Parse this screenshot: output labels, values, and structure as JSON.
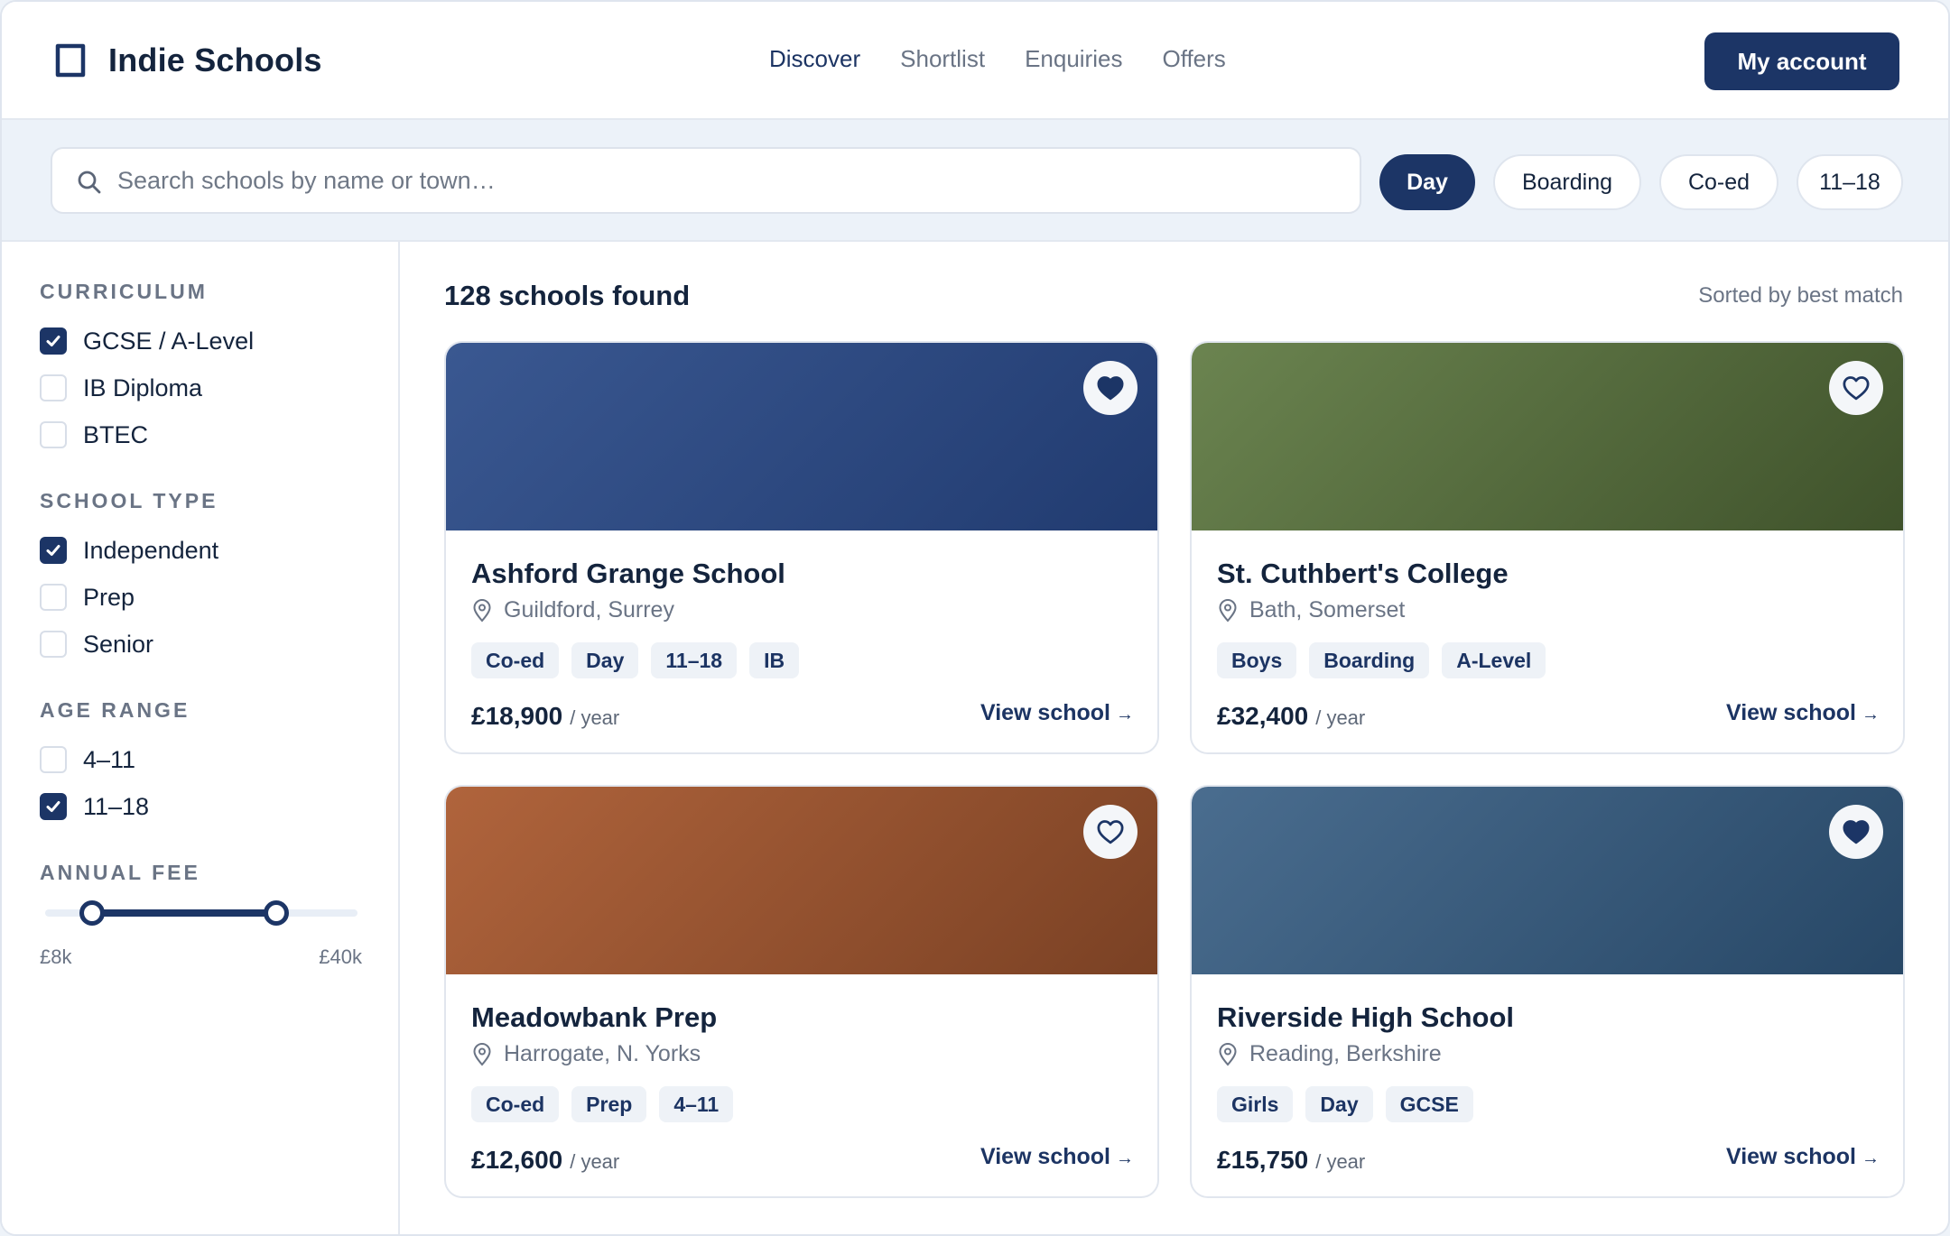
{
  "header": {
    "brand": "Indie Schools",
    "nav": [
      "Discover",
      "Shortlist",
      "Enquiries",
      "Offers"
    ],
    "account_label": "My account"
  },
  "search": {
    "placeholder": "Search schools by name or town…",
    "value": "",
    "chips": [
      {
        "label": "Day",
        "active": true
      },
      {
        "label": "Boarding",
        "active": false
      },
      {
        "label": "Co-ed",
        "active": false
      },
      {
        "label": "11–18",
        "active": false
      }
    ]
  },
  "filters": {
    "curriculum": {
      "title": "CURRICULUM",
      "options": [
        {
          "label": "GCSE / A-Level",
          "checked": true
        },
        {
          "label": "IB Diploma",
          "checked": false
        },
        {
          "label": "BTEC",
          "checked": false
        }
      ]
    },
    "school_type": {
      "title": "SCHOOL TYPE",
      "options": [
        {
          "label": "Independent",
          "checked": true
        },
        {
          "label": "Prep",
          "checked": false
        },
        {
          "label": "Senior",
          "checked": false
        }
      ]
    },
    "age_range": {
      "title": "AGE RANGE",
      "options": [
        {
          "label": "4–11",
          "checked": false
        },
        {
          "label": "11–18",
          "checked": true
        }
      ]
    },
    "annual_fee": {
      "title": "ANNUAL FEE",
      "min_label": "£8k",
      "max_label": "£40k",
      "range_fraction": [
        0.15,
        0.74
      ]
    }
  },
  "results": {
    "count_label": "128 schools found",
    "sort_label": "Sorted by best match",
    "view_label": "View school",
    "view_arrow": "→",
    "schools": [
      {
        "name": "Ashford Grange School",
        "location": "Guildford, Surrey",
        "tags": [
          "Co-ed",
          "Day",
          "11–18",
          "IB"
        ],
        "price": "£18,900",
        "unit": "/ year",
        "favorited": true,
        "colors": [
          "#3a5891",
          "#213b70"
        ]
      },
      {
        "name": "St. Cuthbert's College",
        "location": "Bath, Somerset",
        "tags": [
          "Boys",
          "Boarding",
          "A-Level"
        ],
        "price": "£32,400",
        "unit": "/ year",
        "favorited": false,
        "colors": [
          "#6b8450",
          "#3f522b"
        ]
      },
      {
        "name": "Meadowbank Prep",
        "location": "Harrogate, N. Yorks",
        "tags": [
          "Co-ed",
          "Prep",
          "4–11"
        ],
        "price": "£12,600",
        "unit": "/ year",
        "favorited": false,
        "colors": [
          "#b0643c",
          "#7a4124"
        ]
      },
      {
        "name": "Riverside High School",
        "location": "Reading, Berkshire",
        "tags": [
          "Girls",
          "Day",
          "GCSE"
        ],
        "price": "£15,750",
        "unit": "/ year",
        "favorited": true,
        "colors": [
          "#4a6d8f",
          "#274766"
        ]
      }
    ]
  },
  "colors": {
    "accent": "#1c3566",
    "text": "#14243d",
    "muted": "#6a7485",
    "band": "#ecf2f9"
  }
}
